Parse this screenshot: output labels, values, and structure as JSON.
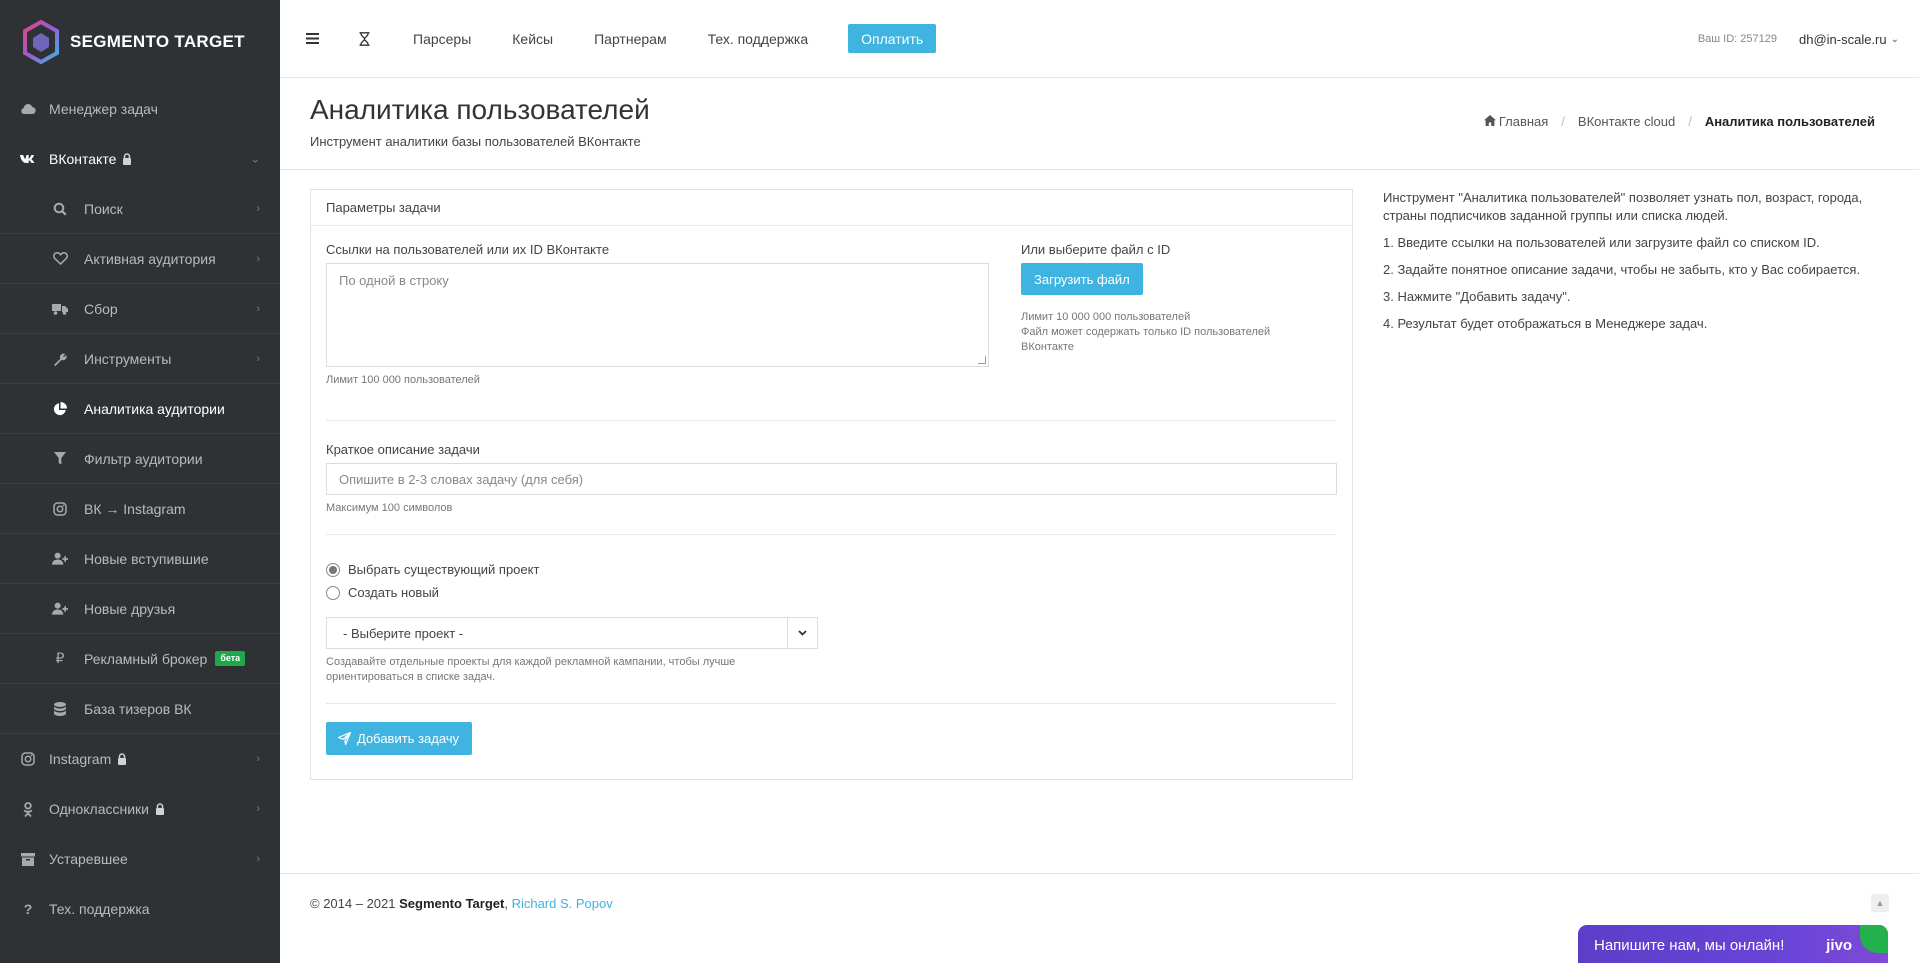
{
  "brand": {
    "name": "SEGMENTO TARGET"
  },
  "sidebar": {
    "top_items": [
      {
        "label": "Менеджер задач",
        "icon": "cloud-icon"
      },
      {
        "label": "ВКонтакте",
        "icon": "vk-icon",
        "locked": true
      }
    ],
    "vk_sub_items": [
      {
        "label": "Поиск",
        "icon": "search-icon",
        "has_children": true
      },
      {
        "label": "Активная аудитория",
        "icon": "heart-icon",
        "has_children": true
      },
      {
        "label": "Сбор",
        "icon": "truck-icon",
        "has_children": true
      },
      {
        "label": "Инструменты",
        "icon": "wrench-icon",
        "has_children": true
      },
      {
        "label": "Аналитика аудитории",
        "icon": "pie-chart-icon",
        "active": true
      },
      {
        "label": "Фильтр аудитории",
        "icon": "filter-icon"
      },
      {
        "label": "ВК → Instagram",
        "icon": "instagram-icon"
      },
      {
        "label": "Новые вступившие",
        "icon": "user-plus-icon"
      },
      {
        "label": "Новые друзья",
        "icon": "user-plus-icon"
      },
      {
        "label": "Рекламный брокер",
        "icon": "ruble-icon",
        "badge": "бета"
      },
      {
        "label": "База тизеров ВК",
        "icon": "database-icon"
      }
    ],
    "bottom_items": [
      {
        "label": "Instagram",
        "icon": "instagram-icon",
        "locked": true
      },
      {
        "label": "Одноклассники",
        "icon": "odnoklassniki-icon",
        "locked": true
      },
      {
        "label": "Устаревшее",
        "icon": "archive-icon"
      },
      {
        "label": "Тех. поддержка",
        "icon": "question-icon"
      }
    ]
  },
  "topbar": {
    "links": [
      "Парсеры",
      "Кейсы",
      "Партнерам",
      "Тех. поддержка"
    ],
    "pay_label": "Оплатить",
    "user_id": "Ваш ID: 257129",
    "user_email": "dh@in-scale.ru"
  },
  "header": {
    "title": "Аналитика пользователей",
    "subtitle": "Инструмент аналитики базы пользователей ВКонтакте",
    "breadcrumb": [
      "Главная",
      "ВКонтакте cloud",
      "Аналитика пользователей"
    ]
  },
  "form": {
    "panel_title": "Параметры задачи",
    "links_label": "Ссылки на пользователей или их ID ВКонтакте",
    "links_placeholder": "По одной в строку",
    "links_limit": "Лимит 100 000 пользователей",
    "file_label": "Или выберите файл с ID",
    "upload_label": "Загрузить файл",
    "file_limit": "Лимит 10 000 000 пользователей",
    "file_note": "Файл может содержать только ID пользователей ВКонтакте",
    "desc_label": "Краткое описание задачи",
    "desc_placeholder": "Опишите в 2-3 словах задачу (для себя)",
    "desc_limit": "Максимум 100 символов",
    "radio_existing": "Выбрать существующий проект",
    "radio_new": "Создать новый",
    "project_select": "- Выберите проект -",
    "project_hint": "Создавайте отдельные проекты для каждой рекламной кампании, чтобы лучше ориентироваться в списке задач.",
    "submit_label": "Добавить задачу"
  },
  "info": {
    "paragraphs": [
      "Инструмент \"Аналитика пользователей\" позволяет узнать пол, возраст, города, страны подписчиков заданной группы или списка людей.",
      "1. Введите ссылки на пользователей или загрузите файл со списком ID.",
      "2. Задайте понятное описание задачи, чтобы не забыть, кто у Вас собирается.",
      "3. Нажмите \"Добавить задачу\".",
      "4. Результат будет отображаться в Менеджере задач."
    ]
  },
  "footer": {
    "years": "© 2014 – 2021",
    "brand": "Segmento Target",
    "author": "Richard S. Popov"
  },
  "chat": {
    "label": "Напишите нам, мы онлайн!",
    "logo": "jivo"
  },
  "colors": {
    "accent": "#3fb4e1",
    "sidebar_bg": "#2f3235",
    "beta_badge": "#1fa84a",
    "chat_bg": "#6a45d8"
  }
}
